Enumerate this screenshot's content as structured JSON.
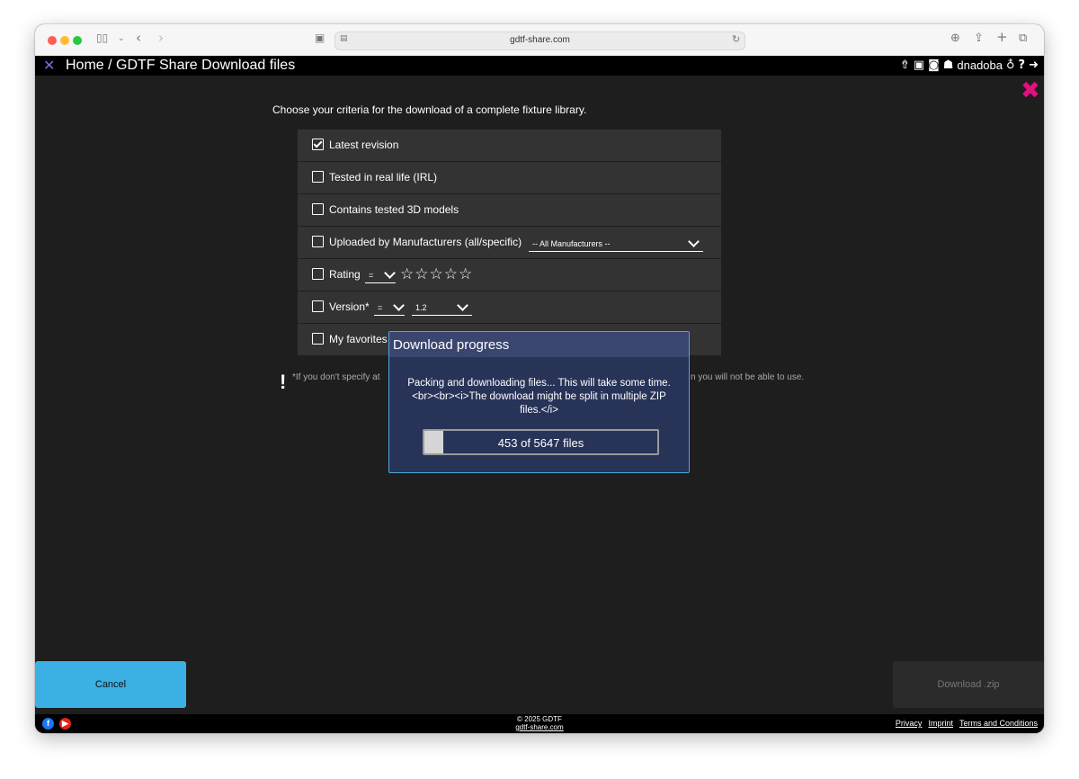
{
  "browser": {
    "url": "gdtf-share.com",
    "colors": {
      "close": "#ff5f57",
      "minimize": "#febc2e",
      "zoom": "#28c840"
    }
  },
  "header": {
    "breadcrumb": "Home / GDTF Share Download files",
    "username": "dnadoba"
  },
  "intro_text": "Choose your criteria for the download of a complete fixture library.",
  "criteria": {
    "latest_revision": {
      "label": "Latest revision",
      "checked": true
    },
    "irl": {
      "label": "Tested in real life (IRL)",
      "checked": false
    },
    "models3d": {
      "label": "Contains tested 3D models",
      "checked": false
    },
    "manufacturers": {
      "label": "Uploaded by Manufacturers (all/specific)",
      "checked": false,
      "selected": "-- All Manufacturers --"
    },
    "rating": {
      "label": "Rating",
      "checked": false,
      "operator": "=",
      "stars": "☆☆☆☆☆"
    },
    "version": {
      "label": "Version*",
      "checked": false,
      "operator": "=",
      "value": "1.2"
    },
    "favorites": {
      "label": "My favorites",
      "checked": false
    }
  },
  "note": {
    "left": "*If you don't specify at",
    "right": "n you will not be able to use."
  },
  "modal": {
    "title": "Download progress",
    "message": "Packing and downloading files... This will take some time.<br><br><i>The download might be split in multiple ZIP files.</i>",
    "progress_text": "453 of 5647 files",
    "progress_fraction": 0.0802
  },
  "buttons": {
    "cancel": "Cancel",
    "download": "Download .zip"
  },
  "footer": {
    "copyright": "© 2025 GDTF",
    "site": "gdtf-share.com",
    "privacy": "Privacy",
    "imprint": "Imprint",
    "terms": "Terms and Conditions"
  },
  "accent_colors": {
    "close_x": "#e0117f",
    "cancel_button": "#3bb0e4",
    "modal_border": "#4aa8e0"
  }
}
